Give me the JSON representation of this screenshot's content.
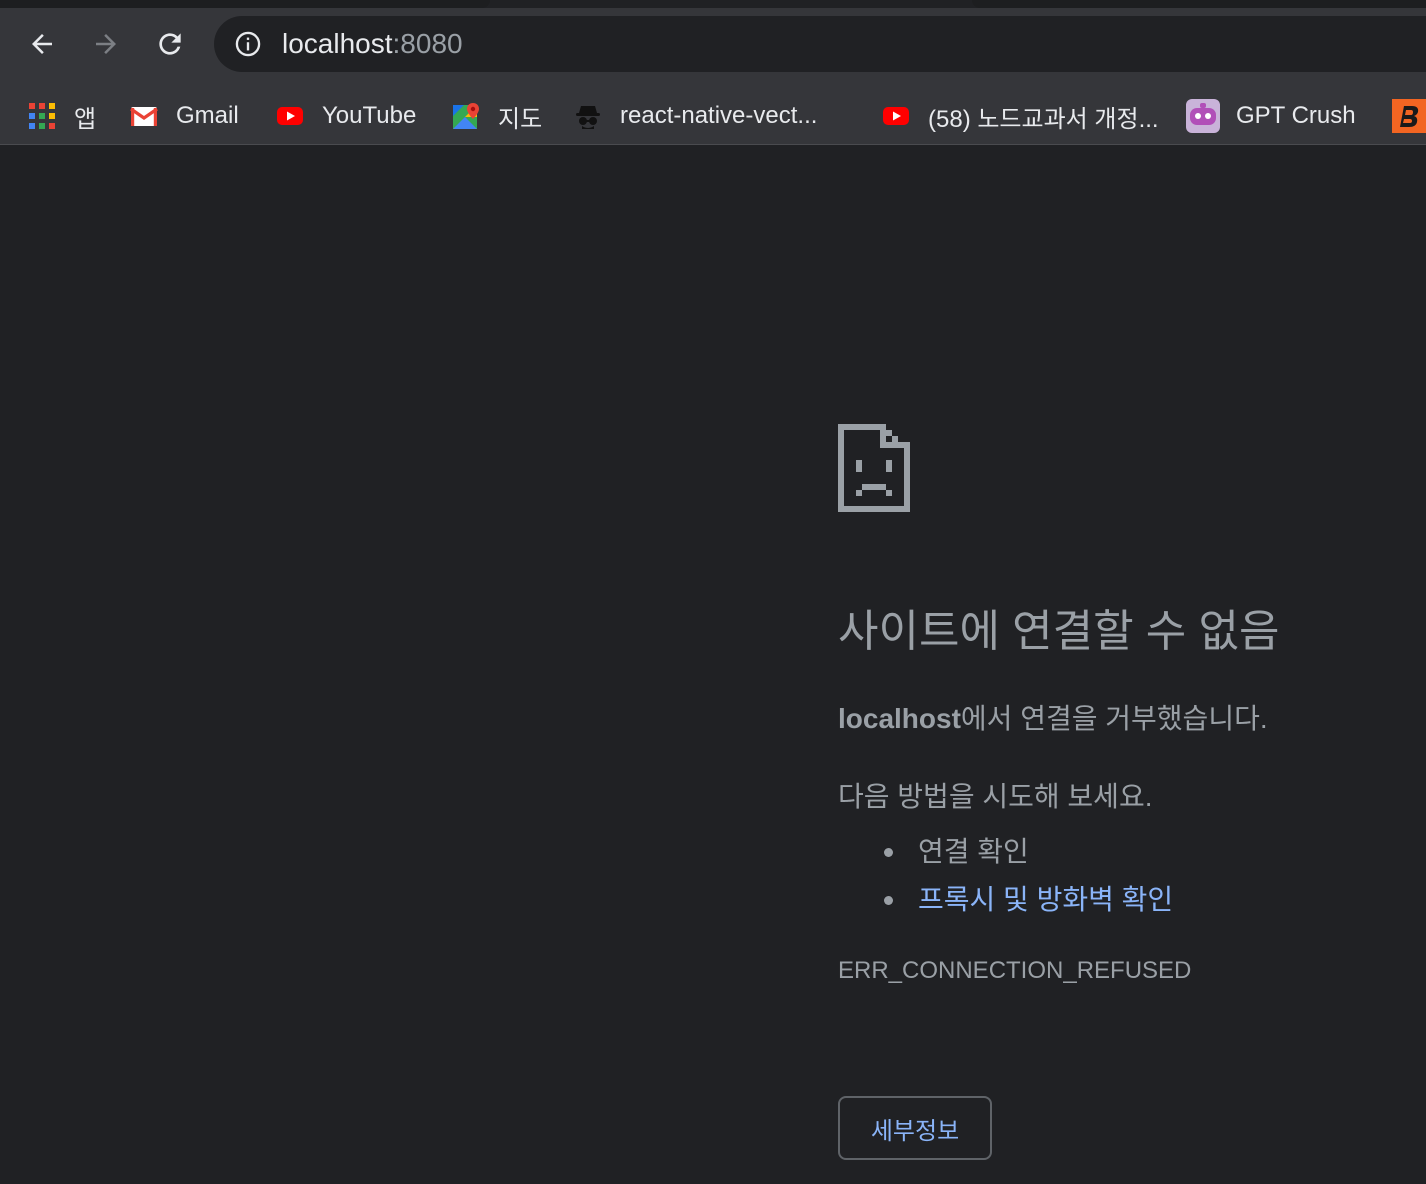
{
  "toolbar": {
    "url_host": "localhost",
    "url_port": ":8080"
  },
  "bookmarks": [
    {
      "label": "앱",
      "icon": "apps-grid-icon"
    },
    {
      "label": "Gmail",
      "icon": "gmail-icon"
    },
    {
      "label": "YouTube",
      "icon": "youtube-icon"
    },
    {
      "label": "지도",
      "icon": "maps-icon"
    },
    {
      "label": "react-native-vect...",
      "icon": "incognito-icon"
    },
    {
      "label": "(58) 노드교과서 개정...",
      "icon": "youtube-icon"
    },
    {
      "label": "GPT Crush",
      "icon": "robot-icon"
    }
  ],
  "error_page": {
    "heading": "사이트에 연결할 수 없음",
    "host": "localhost",
    "desc_rest": "에서 연결을 거부했습니다.",
    "try_intro": "다음 방법을 시도해 보세요.",
    "suggestion_1": "연결 확인",
    "suggestion_2": "프록시 및 방화벽 확인",
    "error_code": "ERR_CONNECTION_REFUSED",
    "details_button": "세부정보"
  },
  "colors": {
    "background": "#202124",
    "toolbar": "#35363a",
    "text": "#9aa0a6",
    "link": "#8ab4f8"
  }
}
